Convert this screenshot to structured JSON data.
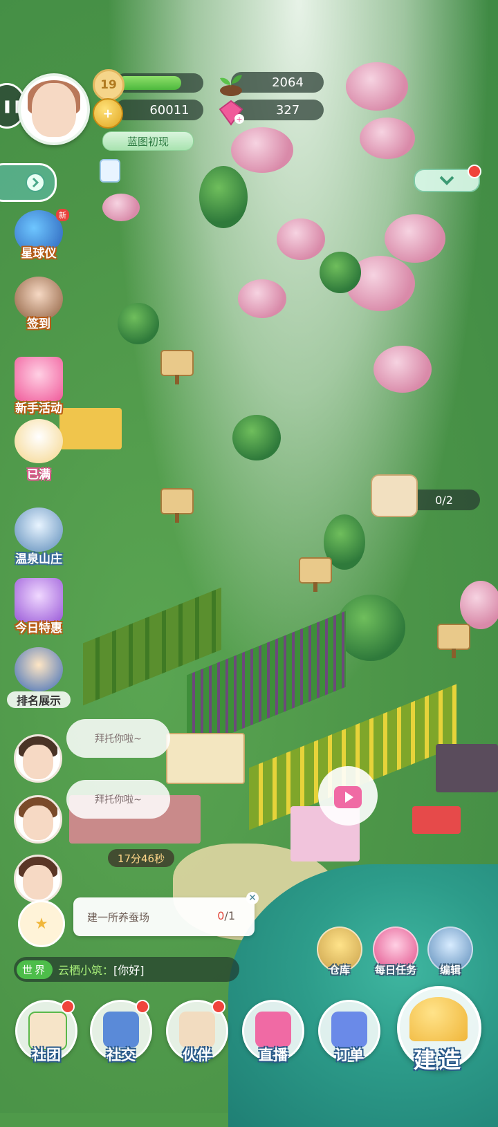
{
  "player": {
    "level": "19",
    "xp_progress": 0.72,
    "coins": "60011",
    "sprouts": "2064",
    "gems": "327",
    "title": "蓝图初现"
  },
  "side_menu": [
    {
      "label": "星球仪",
      "badge": "新"
    },
    {
      "label": "签到"
    },
    {
      "label": "新手活动"
    },
    {
      "label": "已满"
    },
    {
      "label": "温泉山庄"
    },
    {
      "label": "今日特惠"
    },
    {
      "label": "排名展示"
    }
  ],
  "map": {
    "harvest_counter": "0/2"
  },
  "npc_bubbles": [
    "拜托你啦~",
    "拜托你啦~"
  ],
  "timer": "17分46秒",
  "task": {
    "text": "建一所养蚕场",
    "current": "0",
    "total": "/1"
  },
  "chat": {
    "channel": "世界",
    "user": "云栖小筑：",
    "message": "[你好]"
  },
  "quick_buttons": [
    "仓库",
    "每日任务",
    "编辑"
  ],
  "bottom_nav": [
    "社团",
    "社交",
    "伙伴",
    "直播",
    "订单"
  ],
  "build_label": "建造",
  "colors": {
    "accent_green": "#4dbd4a",
    "badge_red": "#f0443c",
    "label_orange_outline": "#b85a14",
    "label_blue_outline": "#2a5a8a"
  }
}
